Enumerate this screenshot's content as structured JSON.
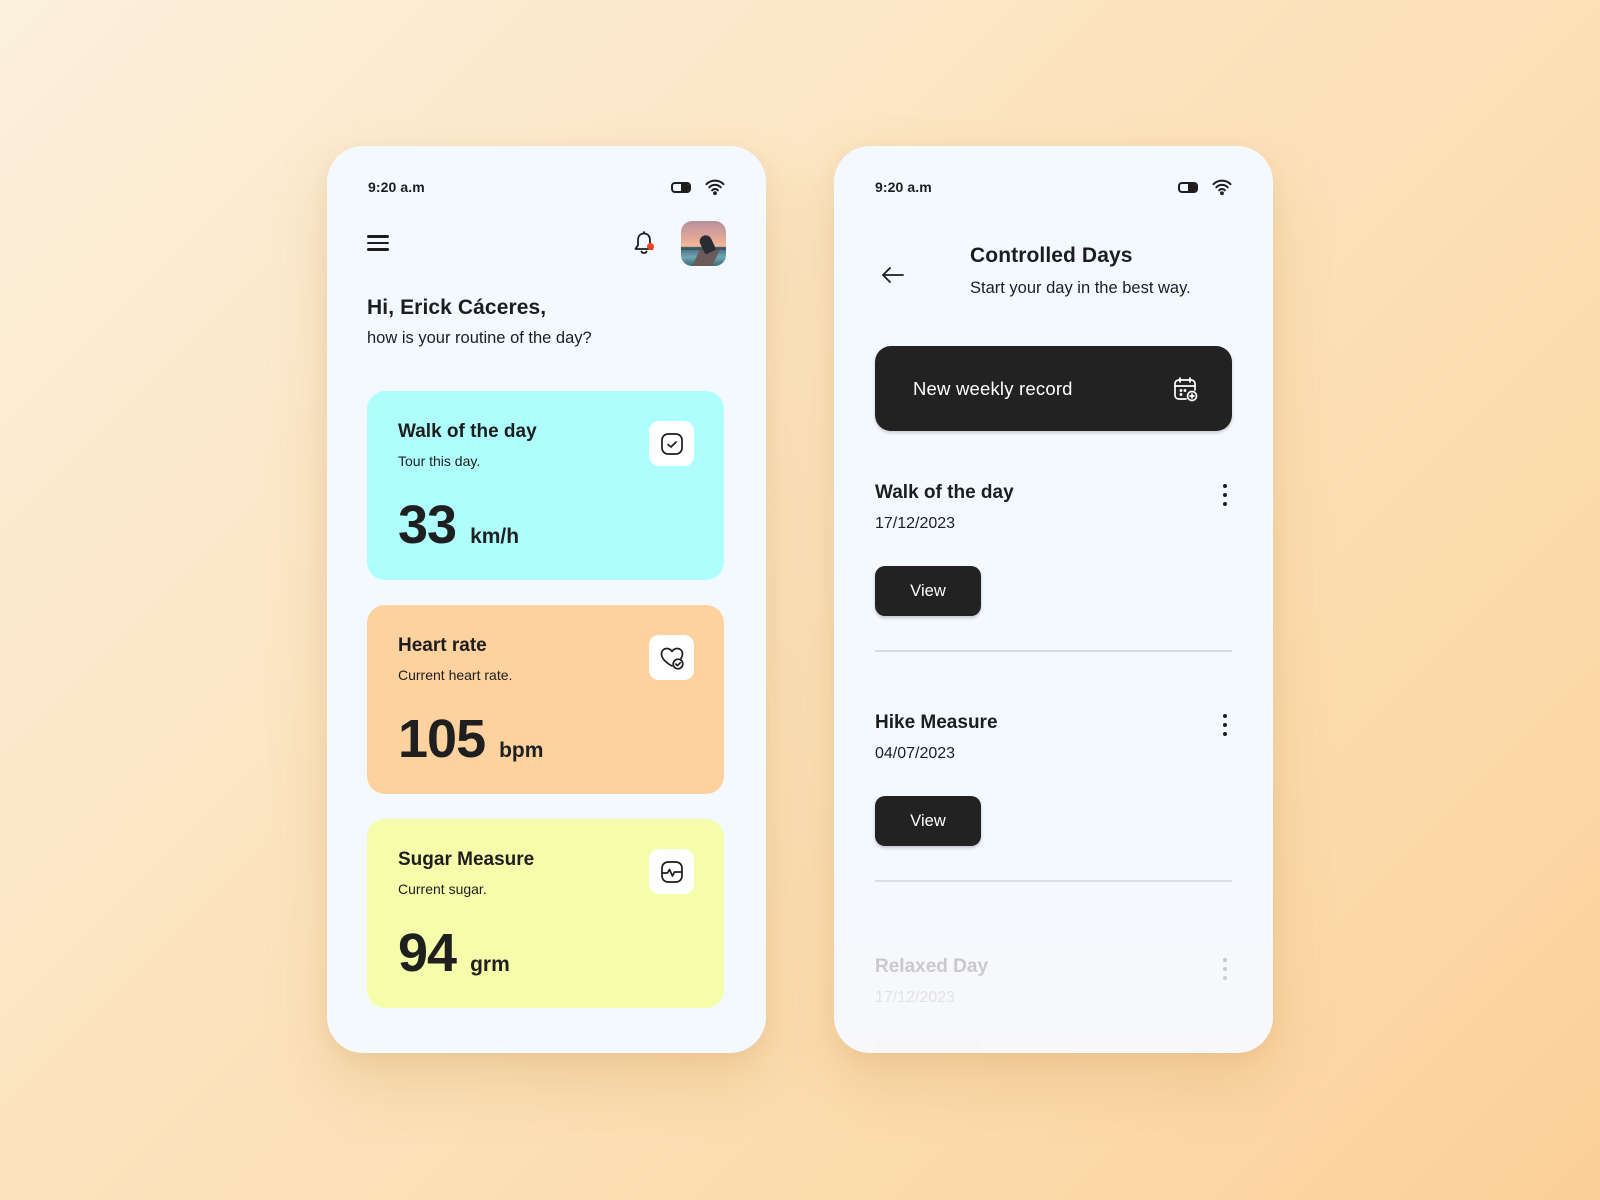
{
  "left_screen": {
    "status_bar": {
      "time": "9:20 a.m",
      "battery_icon": "battery-icon",
      "wifi_icon": "wifi-icon"
    },
    "top_nav": {
      "menu_icon": "hamburger-menu-icon",
      "notification_icon": "bell-icon",
      "has_unread_notification": true,
      "notification_dot_color": "#f5401f",
      "avatar_alt": "User avatar photo"
    },
    "greeting": {
      "title": "Hi, Erick Cáceres,",
      "subtitle": "how is your routine of the day?"
    },
    "cards": [
      {
        "title": "Walk of the day",
        "subtitle": "Tour this day.",
        "value": "33",
        "unit": "km/h",
        "icon": "calendar-check-icon",
        "color": "#affefe"
      },
      {
        "title": "Heart rate",
        "subtitle": "Current heart rate.",
        "value": "105",
        "unit": "bpm",
        "icon": "heart-check-icon",
        "color": "#fdd29f"
      },
      {
        "title": "Sugar Measure",
        "subtitle": "Current sugar.",
        "value": "94",
        "unit": "grm",
        "icon": "pulse-monitor-icon",
        "color": "#f5fdab"
      }
    ]
  },
  "right_screen": {
    "status_bar": {
      "time": "9:20 a.m",
      "battery_icon": "battery-icon",
      "wifi_icon": "wifi-icon"
    },
    "header": {
      "back_icon": "arrow-left-icon",
      "title": "Controlled Days",
      "subtitle": "Start your day in the best way."
    },
    "new_record_button": {
      "label": "New weekly record",
      "icon": "calendar-add-icon"
    },
    "records": [
      {
        "title": "Walk of the day",
        "date": "17/12/2023",
        "button_label": "View",
        "menu_icon": "more-vertical-icon"
      },
      {
        "title": "Hike Measure",
        "date": "04/07/2023",
        "button_label": "View",
        "menu_icon": "more-vertical-icon"
      },
      {
        "title": "Relaxed Day",
        "date": "17/12/2023",
        "button_label": "",
        "menu_icon": "more-vertical-icon"
      }
    ]
  },
  "theme": {
    "dark_button": "#232223",
    "screen_background": "#f4f9ff",
    "text_primary": "#1d1d1d"
  }
}
